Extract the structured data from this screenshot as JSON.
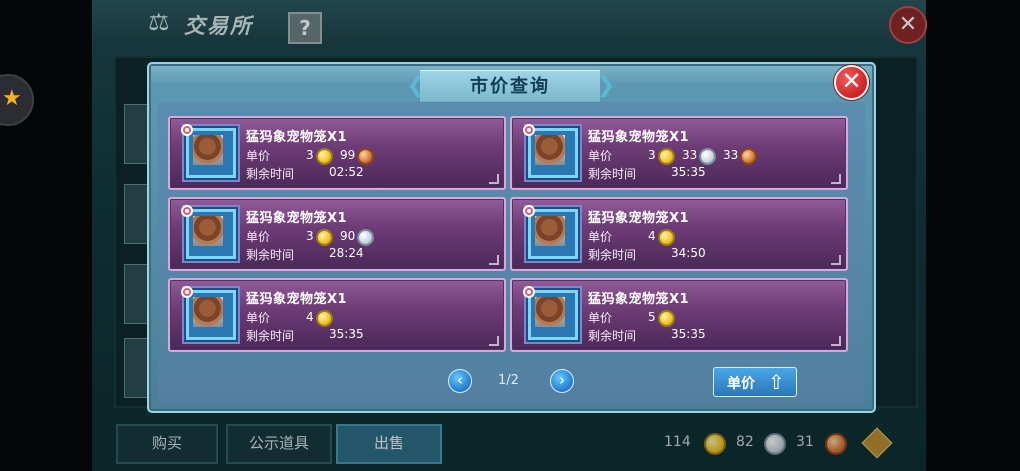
{
  "background": {
    "title": "交易所",
    "help_label": "?",
    "close_label": "✕",
    "bottom_tabs": [
      {
        "label": "购买"
      },
      {
        "label": "公示道具"
      },
      {
        "label": "出售"
      }
    ],
    "currency": [
      {
        "amount": "114",
        "icon": "gold-coin-icon"
      },
      {
        "amount": "82",
        "icon": "silver-coin-icon"
      },
      {
        "amount": "31",
        "icon": "copper-coin-icon"
      }
    ]
  },
  "modal": {
    "title": "市价查询",
    "close_label": "✕",
    "pagination": {
      "current": "1/2",
      "prev_label": "‹",
      "next_label": "›"
    },
    "sort_button": {
      "label": "单价",
      "icon": "arrow-up-icon"
    },
    "listings": [
      {
        "name": "猛犸象宠物笼X1",
        "price_label": "单价",
        "time_label": "剩余时间",
        "time": "02:52",
        "price": [
          {
            "amount": "3",
            "coin": "gold"
          },
          {
            "amount": "99",
            "coin": "copper"
          }
        ]
      },
      {
        "name": "猛犸象宠物笼X1",
        "price_label": "单价",
        "time_label": "剩余时间",
        "time": "35:35",
        "price": [
          {
            "amount": "3",
            "coin": "gold"
          },
          {
            "amount": "33",
            "coin": "silver"
          },
          {
            "amount": "33",
            "coin": "copper"
          }
        ]
      },
      {
        "name": "猛犸象宠物笼X1",
        "price_label": "单价",
        "time_label": "剩余时间",
        "time": "28:24",
        "price": [
          {
            "amount": "3",
            "coin": "gold"
          },
          {
            "amount": "90",
            "coin": "silver"
          }
        ]
      },
      {
        "name": "猛犸象宠物笼X1",
        "price_label": "单价",
        "time_label": "剩余时间",
        "time": "34:50",
        "price": [
          {
            "amount": "4",
            "coin": "gold"
          }
        ]
      },
      {
        "name": "猛犸象宠物笼X1",
        "price_label": "单价",
        "time_label": "剩余时间",
        "time": "35:35",
        "price": [
          {
            "amount": "4",
            "coin": "gold"
          }
        ]
      },
      {
        "name": "猛犸象宠物笼X1",
        "price_label": "单价",
        "time_label": "剩余时间",
        "time": "35:35",
        "price": [
          {
            "amount": "5",
            "coin": "gold"
          }
        ]
      }
    ]
  }
}
